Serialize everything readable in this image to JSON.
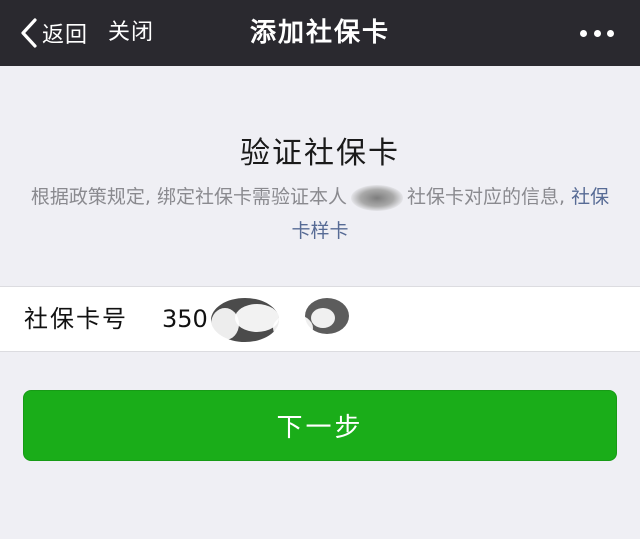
{
  "navbar": {
    "back_label": "返回",
    "close_label": "关闭",
    "title": "添加社保卡",
    "back_icon": "chevron-left-icon",
    "more_icon": "more-dots-icon"
  },
  "verify": {
    "title": "验证社保卡",
    "desc_part1": "根据政策规定, 绑定社保卡需验证本人",
    "desc_part2": "社保卡对应的信息,",
    "sample_link": "社保卡样卡"
  },
  "card_field": {
    "label": "社保卡号",
    "value": "350"
  },
  "actions": {
    "next_label": "下一步"
  },
  "colors": {
    "navbar_bg": "#2a292f",
    "page_bg": "#efeff4",
    "button_green": "#1aad19",
    "link_blue": "#576b95",
    "desc_gray": "#8a8a8f"
  }
}
